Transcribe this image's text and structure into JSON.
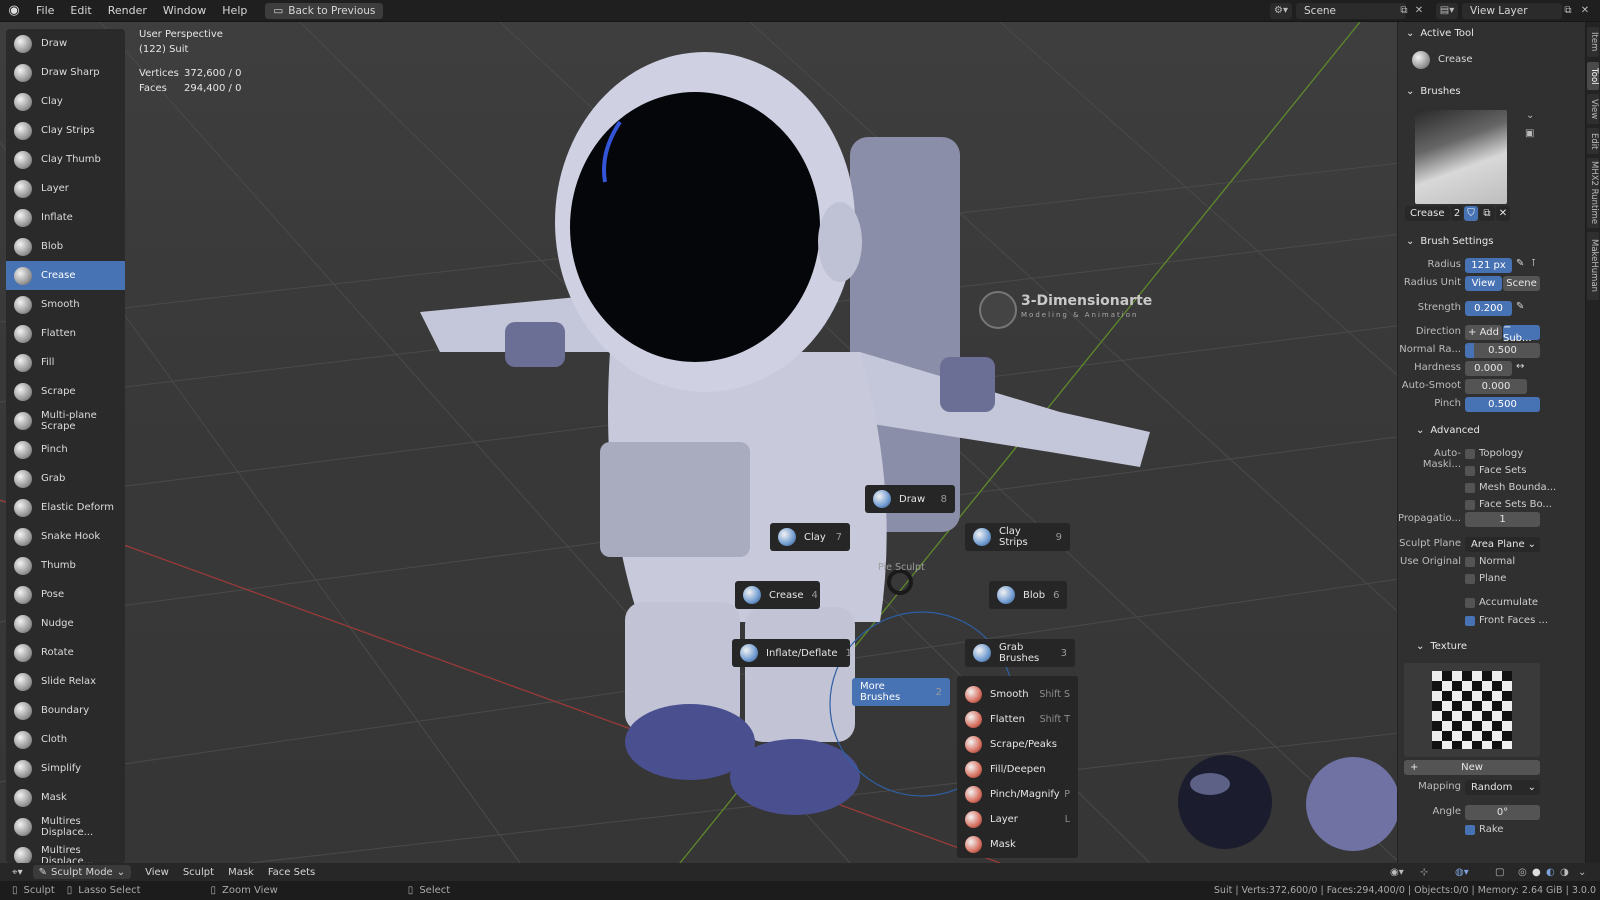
{
  "menu": {
    "items": [
      "File",
      "Edit",
      "Render",
      "Window",
      "Help"
    ],
    "back_label": "Back to Previous",
    "scene": "Scene",
    "view_layer": "View Layer"
  },
  "overlay": {
    "perspective": "User Perspective",
    "object": "(122) Suit",
    "vertices_label": "Vertices",
    "vertices_value": "372,600 / 0",
    "faces_label": "Faces",
    "faces_value": "294,400 / 0"
  },
  "toolbar": {
    "items": [
      "Draw",
      "Draw Sharp",
      "Clay",
      "Clay Strips",
      "Clay Thumb",
      "Layer",
      "Inflate",
      "Blob",
      "Crease",
      "Smooth",
      "Flatten",
      "Fill",
      "Scrape",
      "Multi-plane Scrape",
      "Pinch",
      "Grab",
      "Elastic Deform",
      "Snake Hook",
      "Thumb",
      "Pose",
      "Nudge",
      "Rotate",
      "Slide Relax",
      "Boundary",
      "Cloth",
      "Simplify",
      "Mask",
      "Multires Displace...",
      "Multires Displace..."
    ],
    "active": "Crease"
  },
  "watermark": {
    "title": "3-Dimensionarte",
    "subtitle": "Modeling & Animation"
  },
  "pie": {
    "title": "Pie Sculpt",
    "items": [
      {
        "label": "Draw",
        "key": "8"
      },
      {
        "label": "Clay",
        "key": "7"
      },
      {
        "label": "Clay Strips",
        "key": "9"
      },
      {
        "label": "Crease",
        "key": "4"
      },
      {
        "label": "Blob",
        "key": "6"
      },
      {
        "label": "Inflate/Deflate",
        "key": "1"
      },
      {
        "label": "Grab Brushes",
        "key": "3"
      },
      {
        "label": "More Brushes",
        "key": "2"
      }
    ],
    "submenu": [
      {
        "label": "Smooth",
        "shortcut": "Shift S"
      },
      {
        "label": "Flatten",
        "shortcut": "Shift T"
      },
      {
        "label": "Scrape/Peaks",
        "shortcut": ""
      },
      {
        "label": "Fill/Deepen",
        "shortcut": ""
      },
      {
        "label": "Pinch/Magnify",
        "shortcut": "P"
      },
      {
        "label": "Layer",
        "shortcut": "L"
      },
      {
        "label": "Mask",
        "shortcut": ""
      }
    ]
  },
  "panel": {
    "active_tool_head": "Active Tool",
    "active_tool": "Crease",
    "brushes_head": "Brushes",
    "brush_name": "Crease",
    "brush_users": "2",
    "brush_settings_head": "Brush Settings",
    "radius_label": "Radius",
    "radius": "121 px",
    "radius_unit_label": "Radius Unit",
    "radius_unit_view": "View",
    "radius_unit_scene": "Scene",
    "strength_label": "Strength",
    "strength": "0.200",
    "direction_label": "Direction",
    "dir_add": "+ Add",
    "dir_sub": "− Sub...",
    "normal_label": "Normal Ra...",
    "normal": "0.500",
    "hardness_label": "Hardness",
    "hardness": "0.000",
    "autosmooth_label": "Auto-Smoot",
    "autosmooth": "0.000",
    "pinch_label": "Pinch",
    "pinch": "0.500",
    "advanced_head": "Advanced",
    "automask_label": "Auto-Maski...",
    "automask": [
      "Topology",
      "Face Sets",
      "Mesh Bounda...",
      "Face Sets Bo..."
    ],
    "propagation_label": "Propagatio...",
    "propagation": "1",
    "sculpt_plane_label": "Sculpt Plane",
    "sculpt_plane": "Area Plane",
    "use_original_label": "Use Original",
    "use_original": [
      "Normal",
      "Plane"
    ],
    "accumulate": "Accumulate",
    "front_faces": "Front Faces ...",
    "texture_head": "Texture",
    "new_label": "New",
    "mapping_label": "Mapping",
    "mapping": "Random",
    "angle_label": "Angle",
    "angle": "0°",
    "rake": "Rake"
  },
  "sidetabs": [
    "Item",
    "Tool",
    "View",
    "Edit",
    "MHX2 Runtime",
    "MakeHuman"
  ],
  "header": {
    "mode": "Sculpt Mode",
    "items": [
      "View",
      "Sculpt",
      "Mask",
      "Face Sets"
    ]
  },
  "status": {
    "left": [
      "Sculpt",
      "Lasso Select",
      "Zoom View",
      "Select"
    ],
    "right": "Suit | Verts:372,600/0 | Faces:294,400/0 | Objects:0/0 | Memory: 2.64 GiB | 3.0.0"
  },
  "colors": {
    "accent": "#4772b3",
    "suit": "#c6c8dc",
    "boots": "#4a4f8f"
  }
}
